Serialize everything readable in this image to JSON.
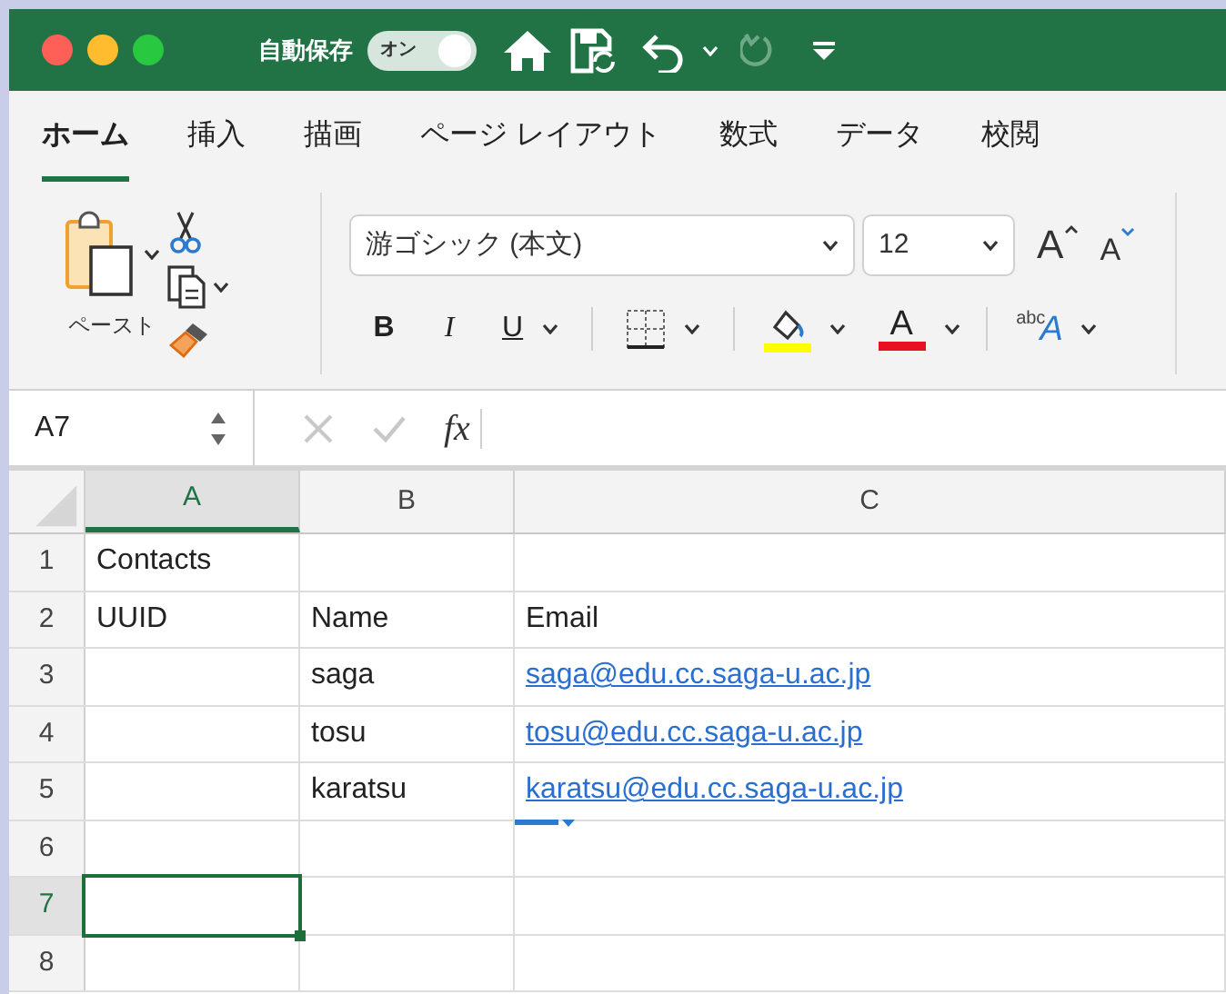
{
  "title_bar": {
    "autosave_label": "自動保存",
    "autosave_toggle": {
      "label": "オン",
      "on": true
    }
  },
  "tabs": [
    {
      "label": "ホーム",
      "selected": true
    },
    {
      "label": "挿入",
      "selected": false
    },
    {
      "label": "描画",
      "selected": false
    },
    {
      "label": "ページ レイアウト",
      "selected": false
    },
    {
      "label": "数式",
      "selected": false
    },
    {
      "label": "データ",
      "selected": false
    },
    {
      "label": "校閲",
      "selected": false
    }
  ],
  "ribbon": {
    "paste_label": "ペースト",
    "font_name": "游ゴシック (本文)",
    "font_size": "12",
    "grow_font": "A",
    "shrink_font": "A",
    "bold": "B",
    "italic": "I",
    "underline": "U",
    "font_color": "A",
    "orientation_small": "abc",
    "orientation_big": "A"
  },
  "formula_bar": {
    "cell_reference": "A7",
    "function_label": "fx"
  },
  "sheet": {
    "columns": [
      {
        "label": "A",
        "selected": true
      },
      {
        "label": "B",
        "selected": false
      },
      {
        "label": "C",
        "selected": false
      }
    ],
    "rows": [
      {
        "number": "1",
        "selected": false,
        "cells": [
          {
            "kind": "text",
            "text": "Contacts"
          },
          {
            "kind": "text",
            "text": ""
          },
          {
            "kind": "text",
            "text": ""
          }
        ]
      },
      {
        "number": "2",
        "selected": false,
        "cells": [
          {
            "kind": "text",
            "text": "UUID"
          },
          {
            "kind": "text",
            "text": "Name"
          },
          {
            "kind": "text",
            "text": "Email"
          }
        ]
      },
      {
        "number": "3",
        "selected": false,
        "cells": [
          {
            "kind": "text",
            "text": ""
          },
          {
            "kind": "text",
            "text": "saga"
          },
          {
            "kind": "link",
            "text": "saga@edu.cc.saga-u.ac.jp"
          }
        ]
      },
      {
        "number": "4",
        "selected": false,
        "cells": [
          {
            "kind": "text",
            "text": ""
          },
          {
            "kind": "text",
            "text": "tosu"
          },
          {
            "kind": "link",
            "text": "tosu@edu.cc.saga-u.ac.jp"
          }
        ]
      },
      {
        "number": "5",
        "selected": false,
        "cells": [
          {
            "kind": "text",
            "text": ""
          },
          {
            "kind": "text",
            "text": "karatsu"
          },
          {
            "kind": "link",
            "text": "karatsu@edu.cc.saga-u.ac.jp"
          }
        ]
      },
      {
        "number": "6",
        "selected": false,
        "cells": [
          {
            "kind": "text",
            "text": ""
          },
          {
            "kind": "text",
            "text": ""
          },
          {
            "kind": "text",
            "text": ""
          }
        ]
      },
      {
        "number": "7",
        "selected": true,
        "cells": [
          {
            "kind": "text",
            "text": ""
          },
          {
            "kind": "text",
            "text": ""
          },
          {
            "kind": "text",
            "text": ""
          }
        ]
      },
      {
        "number": "8",
        "selected": false,
        "cells": [
          {
            "kind": "text",
            "text": ""
          },
          {
            "kind": "text",
            "text": ""
          },
          {
            "kind": "text",
            "text": ""
          }
        ]
      }
    ]
  }
}
